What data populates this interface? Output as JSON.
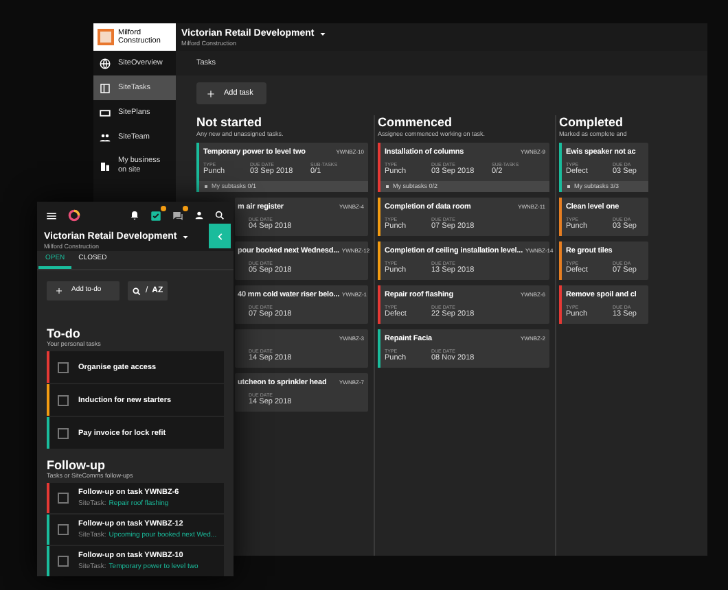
{
  "desktop": {
    "logo_text": "Milford Construction",
    "project": "Victorian Retail Development",
    "company": "Milford Construction",
    "nav": [
      {
        "label": "SiteOverview",
        "selected": false
      },
      {
        "label": "SiteTasks",
        "selected": true
      },
      {
        "label": "SitePlans",
        "selected": false
      },
      {
        "label": "SiteTeam",
        "selected": false
      },
      {
        "label": "My business on site",
        "selected": false
      }
    ],
    "tab": "Tasks",
    "add_button": "Add task",
    "columns": [
      {
        "title": "Not started",
        "subtitle": "Any new and unassigned tasks.",
        "cards": [
          {
            "title": "Temporary power to level two",
            "id": "YWNBZ-10",
            "color": "#1abc9c",
            "fields": [
              {
                "label": "TYPE",
                "value": "Punch"
              },
              {
                "label": "DUE DATE",
                "value": "03 Sep 2018"
              },
              {
                "label": "SUB-TASKS",
                "value": "0/1"
              }
            ],
            "subtasks": "My subtasks 0/1"
          },
          {
            "title": "m air register",
            "id": "YWNBZ-4",
            "fields": [
              {
                "label": "DUE DATE",
                "value": "04 Sep 2018"
              }
            ]
          },
          {
            "title": "pour booked next Wednesd...",
            "id": "YWNBZ-12",
            "fields": [
              {
                "label": "DUE DATE",
                "value": "05 Sep 2018"
              }
            ]
          },
          {
            "title": "40 mm cold water riser belo...",
            "id": "YWNBZ-1",
            "fields": [
              {
                "label": "DUE DATE",
                "value": "07 Sep 2018"
              }
            ]
          },
          {
            "id": "YWNBZ-3",
            "fields": [
              {
                "label": "DUE DATE",
                "value": "14 Sep 2018"
              }
            ]
          },
          {
            "title": "utcheon to sprinkler head",
            "id": "YWNBZ-7",
            "fields": [
              {
                "label": "DUE DATE",
                "value": "14 Sep 2018"
              }
            ]
          }
        ]
      },
      {
        "title": "Commenced",
        "subtitle": "Assignee commenced working on task.",
        "cards": [
          {
            "title": "Installation of columns",
            "id": "YWNBZ-9",
            "color": "#e53935",
            "fields": [
              {
                "label": "TYPE",
                "value": "Punch"
              },
              {
                "label": "DUE DATE",
                "value": "03 Sep 2018"
              },
              {
                "label": "SUB-TASKS",
                "value": "0/2"
              }
            ],
            "subtasks": "My subtasks 0/2"
          },
          {
            "title": "Completion of data room",
            "id": "YWNBZ-11",
            "color": "#f39c12",
            "fields": [
              {
                "label": "TYPE",
                "value": "Punch"
              },
              {
                "label": "DUE DATE",
                "value": "07 Sep 2018"
              }
            ]
          },
          {
            "title": "Completion of ceiling installation level...",
            "id": "YWNBZ-14",
            "color": "#f39c12",
            "fields": [
              {
                "label": "TYPE",
                "value": "Punch"
              },
              {
                "label": "DUE DATE",
                "value": "13 Sep 2018"
              }
            ]
          },
          {
            "title": "Repair roof flashing",
            "id": "YWNBZ-6",
            "color": "#e53935",
            "fields": [
              {
                "label": "TYPE",
                "value": "Defect"
              },
              {
                "label": "DUE DATE",
                "value": "22 Sep 2018"
              }
            ]
          },
          {
            "title": "Repaint Facia",
            "id": "YWNBZ-2",
            "color": "#1abc9c",
            "fields": [
              {
                "label": "TYPE",
                "value": "Punch"
              },
              {
                "label": "DUE DATE",
                "value": "08 Nov 2018"
              }
            ]
          }
        ]
      },
      {
        "title": "Completed",
        "subtitle": "Marked as complete and",
        "cards": [
          {
            "title": "Ewis speaker not ac",
            "color": "#1abc9c",
            "fields": [
              {
                "label": "TYPE",
                "value": "Defect"
              },
              {
                "label": "DUE DA",
                "value": "03 Sep"
              }
            ],
            "subtasks": "My subtasks 3/3"
          },
          {
            "title": "Clean level one",
            "color": "#e67e22",
            "fields": [
              {
                "label": "TYPE",
                "value": "Punch"
              },
              {
                "label": "DUE DA",
                "value": "03 Sep"
              }
            ]
          },
          {
            "title": "Re grout tiles",
            "color": "#e67e22",
            "fields": [
              {
                "label": "TYPE",
                "value": "Defect"
              },
              {
                "label": "DUE DA",
                "value": "07 Sep"
              }
            ]
          },
          {
            "title": "Remove spoil and cl",
            "color": "#e53935",
            "fields": [
              {
                "label": "TYPE",
                "value": "Punch"
              },
              {
                "label": "DUE DA",
                "value": "13 Sep"
              }
            ]
          }
        ]
      }
    ]
  },
  "mobile": {
    "project": "Victorian Retail Development",
    "company": "Milford Construction",
    "tabs": [
      {
        "label": "OPEN",
        "selected": true
      },
      {
        "label": "CLOSED",
        "selected": false
      }
    ],
    "add_button": "Add to-do",
    "sort_separator": "/",
    "sort_label": "AZ",
    "todo": {
      "title": "To-do",
      "subtitle": "Your personal tasks",
      "items": [
        {
          "label": "Organise gate access",
          "color": "#e53935",
          "checked": false
        },
        {
          "label": "Induction for new starters",
          "color": "#f39c12",
          "checked": false
        },
        {
          "label": "Pay invoice for lock refit",
          "color": "#1abc9c",
          "checked": false
        }
      ]
    },
    "followup": {
      "title": "Follow-up",
      "subtitle": "Tasks or SiteComms follow-ups",
      "items": [
        {
          "label": "Follow-up on task YWNBZ-6",
          "prefix": "SiteTask:",
          "link": "Repair roof flashing",
          "color": "#e53935",
          "checked": false
        },
        {
          "label": "Follow-up on task YWNBZ-12",
          "prefix": "SiteTask:",
          "link": "Upcoming pour booked next Wed...",
          "color": "#1abc9c",
          "checked": false
        },
        {
          "label": "Follow-up on task YWNBZ-10",
          "prefix": "SiteTask:",
          "link": "Temporary power to level two",
          "color": "#1abc9c",
          "checked": false
        }
      ]
    }
  }
}
